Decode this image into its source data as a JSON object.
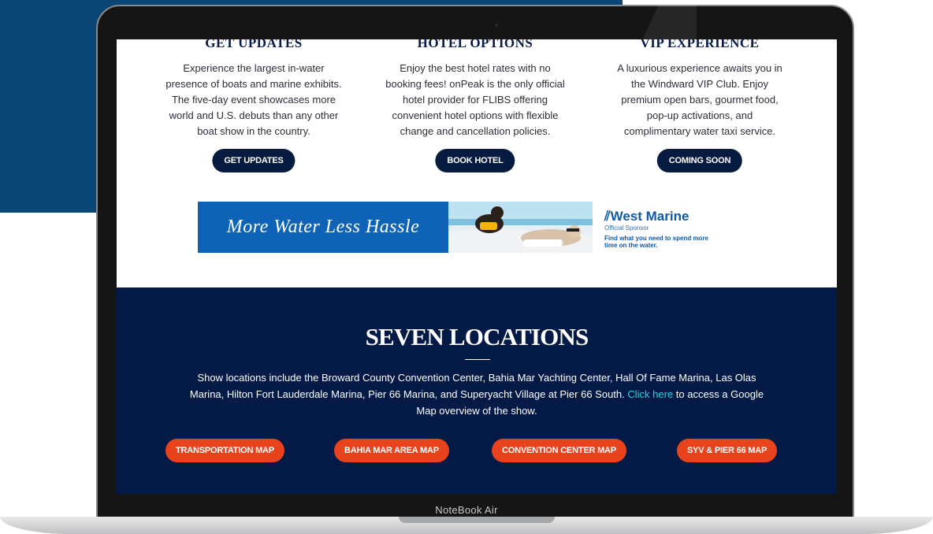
{
  "device": {
    "label": "NoteBook Air"
  },
  "features": [
    {
      "title": "GET UPDATES",
      "lines": [
        "Experience the largest in-water",
        "presence of boats and marine exhibits.",
        "The five-day event showcases more",
        "world and U.S. debuts than any other",
        "boat show in the country."
      ],
      "button": "GET UPDATES"
    },
    {
      "title": "HOTEL OPTIONS",
      "lines": [
        "Enjoy the best hotel rates with no",
        "booking fees! onPeak is the only official",
        "hotel provider for FLIBS offering",
        "convenient hotel options with flexible",
        "change and cancellation policies."
      ],
      "button": "BOOK HOTEL"
    },
    {
      "title": "VIP EXPERIENCE",
      "lines": [
        "A luxurious experience awaits you in",
        "the Windward VIP Club. Enjoy",
        "premium open bars, gourmet food,",
        "pop-up activations, and",
        "complimentary water taxi service."
      ],
      "button": "COMING SOON"
    }
  ],
  "ad": {
    "slogan": "More Water Less Hassle",
    "brand": "West Marine",
    "brand_sub": "Official Sponsor",
    "tagline_1": "Find what you need to spend more",
    "tagline_2": "time on the water."
  },
  "locations": {
    "title": "SEVEN LOCATIONS",
    "text_1": "Show locations include the Broward County Convention Center, Bahia Mar Yachting Center, Hall Of Fame Marina, Las Olas",
    "text_2a": "Marina, Hilton Fort Lauderdale Marina, Pier 66 Marina, and Superyacht Village at Pier 66 South. ",
    "link": "Click here",
    "text_2b": " to access a Google",
    "text_3": "Map overview of the show.",
    "buttons": [
      "TRANSPORTATION MAP",
      "BAHIA MAR AREA MAP",
      "CONVENTION CENTER MAP",
      "SYV & PIER 66 MAP"
    ]
  },
  "colors": {
    "navy": "#021a45",
    "accent_red": "#e8431d",
    "link_cyan": "#2bd0e0",
    "brand_blue": "#0f63b6"
  }
}
